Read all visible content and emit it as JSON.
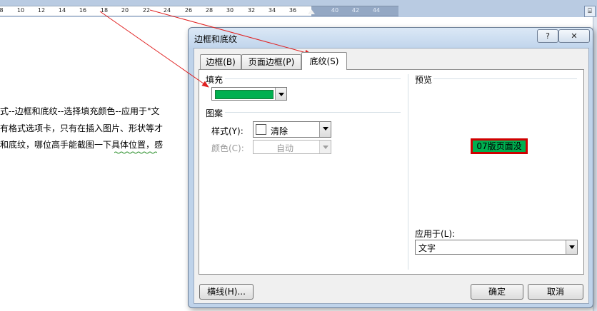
{
  "ruler": {
    "ticks": [
      "8",
      "10",
      "12",
      "14",
      "16",
      "18",
      "20",
      "22",
      "24",
      "26",
      "28",
      "30",
      "32",
      "34",
      "36",
      "40",
      "42",
      "44"
    ]
  },
  "document": {
    "lines": [
      "式--边框和底纹--选择填充颜色--应用于\"文",
      "有格式选项卡，只有在插入图片、形状等才",
      "和底纹，哪位高手能截图一下具体位置，感"
    ]
  },
  "dialog": {
    "title": "边框和底纹",
    "help": "?",
    "close": "✕",
    "tabs": [
      {
        "label": "边框(B)"
      },
      {
        "label": "页面边框(P)"
      },
      {
        "label": "底纹(S)"
      }
    ],
    "fill": {
      "label": "填充",
      "color": "#00b050"
    },
    "pattern": {
      "label": "图案",
      "style_label": "样式(Y):",
      "style_value": "清除",
      "color_label": "颜色(C):",
      "color_value": "自动"
    },
    "preview": {
      "label": "预览",
      "sample_text": "07版页面没",
      "fill_color": "#00b050",
      "border_color": "#d00000"
    },
    "apply_to": {
      "label": "应用于(L):",
      "value": "文字"
    },
    "buttons": {
      "horizontal_line": "横线(H)...",
      "ok": "确定",
      "cancel": "取消"
    }
  },
  "annotations": {
    "arrow_color": "#e02020"
  }
}
